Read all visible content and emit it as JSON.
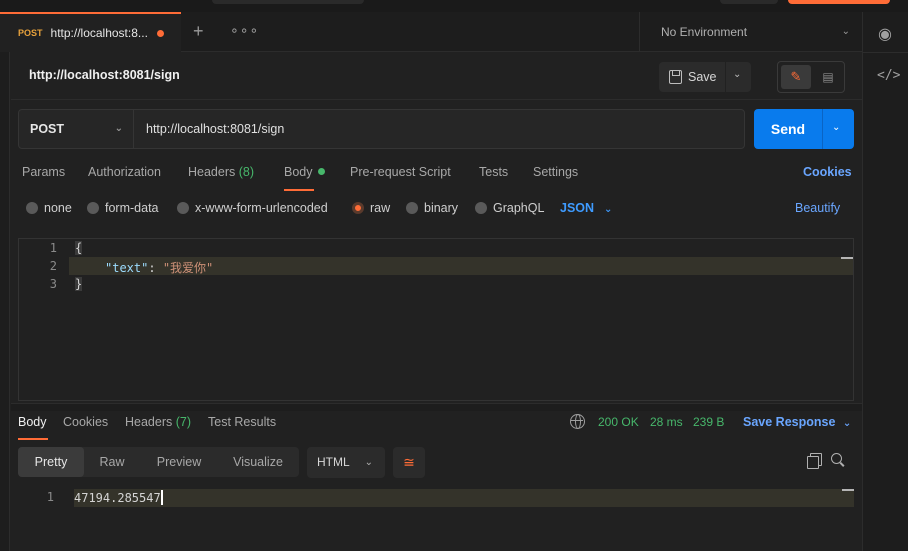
{
  "tab": {
    "method": "POST",
    "title": "http://localhost:8..."
  },
  "environment": {
    "label": "No Environment"
  },
  "header": {
    "title": "http://localhost:8081/sign",
    "save_label": "Save"
  },
  "request": {
    "method": "POST",
    "url": "http://localhost:8081/sign",
    "send_label": "Send"
  },
  "request_tabs": {
    "params": "Params",
    "authorization": "Authorization",
    "headers": "Headers",
    "headers_count": "(8)",
    "body": "Body",
    "pre_request": "Pre-request Script",
    "tests": "Tests",
    "settings": "Settings",
    "cookies": "Cookies"
  },
  "body_types": {
    "none": "none",
    "form_data": "form-data",
    "urlencoded": "x-www-form-urlencoded",
    "raw": "raw",
    "binary": "binary",
    "graphql": "GraphQL",
    "format": "JSON",
    "beautify": "Beautify",
    "selected": "raw"
  },
  "editor": {
    "lines": [
      {
        "num": "1",
        "text": "{"
      },
      {
        "num": "2",
        "key": "\"text\"",
        "sep": ": ",
        "value": "\"我爱你\""
      },
      {
        "num": "3",
        "text": "}"
      }
    ]
  },
  "response": {
    "tabs": {
      "body": "Body",
      "cookies": "Cookies",
      "headers": "Headers",
      "headers_count": "(7)",
      "test_results": "Test Results"
    },
    "status": "200 OK",
    "time": "28 ms",
    "size": "239 B",
    "save_response": "Save Response",
    "views": {
      "pretty": "Pretty",
      "raw": "Raw",
      "preview": "Preview",
      "visualize": "Visualize"
    },
    "language": "HTML",
    "line_num": "1",
    "value": "47194.285547"
  },
  "colors": {
    "accent": "#ff6c37",
    "send": "#097bed",
    "link": "#6aa6ff",
    "status_ok": "#47b76b"
  }
}
